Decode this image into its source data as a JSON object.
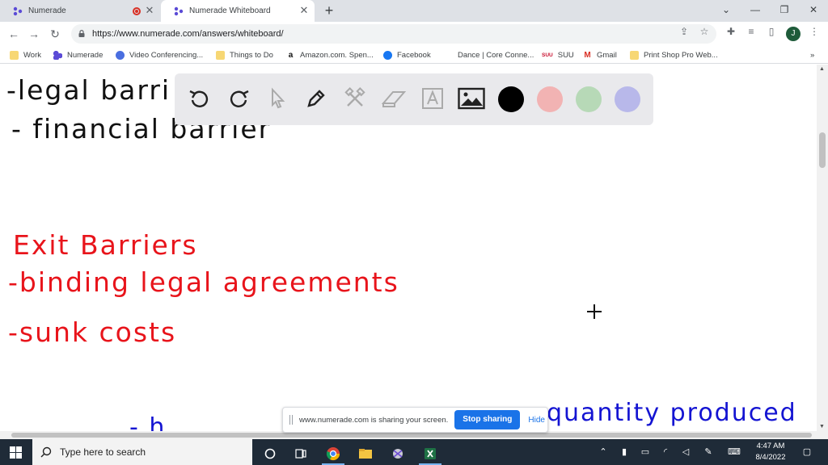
{
  "browser": {
    "tabs": [
      {
        "label": "Numerade",
        "recording": true
      },
      {
        "label": "Numerade Whiteboard",
        "active": true
      }
    ],
    "new_tab_symbol": "+",
    "window_controls": [
      "chevron-down",
      "minimize",
      "restore",
      "close"
    ],
    "url": "https://www.numerade.com/answers/whiteboard/",
    "profile_initial": "J",
    "bookmarks": [
      {
        "label": "Work",
        "icon": "folder-icon"
      },
      {
        "label": "Numerade",
        "icon": "numerade-icon"
      },
      {
        "label": "Video Conferencing...",
        "icon": "video-icon"
      },
      {
        "label": "Things to Do",
        "icon": "folder-icon"
      },
      {
        "label": "Amazon.com. Spen...",
        "icon": "amazon-icon"
      },
      {
        "label": "Facebook",
        "icon": "facebook-icon"
      },
      {
        "label": "Dance | Core Conne...",
        "icon": "page-icon"
      },
      {
        "label": "SUU",
        "icon": "suu-icon",
        "badge": "SUU"
      },
      {
        "label": "Gmail",
        "icon": "gmail-icon"
      },
      {
        "label": "Print Shop Pro Web...",
        "icon": "folder-icon"
      }
    ],
    "more_bookmarks": "»"
  },
  "whiteboard": {
    "handwriting": {
      "line1": "-legal barri",
      "line2": "- financial barrier",
      "exit_title": "Exit Barriers",
      "exit_item1": "-binding legal agreements",
      "exit_item2": "-sunk costs",
      "bottom_left_fragment": "- h",
      "bottom_right": "quantity produced"
    },
    "ink_colors": {
      "black": "#111111",
      "red": "#e8141b",
      "blue": "#1414d2"
    },
    "toolbar": {
      "tools": [
        "undo-icon",
        "redo-icon",
        "pointer-icon",
        "pen-icon",
        "tools-icon",
        "eraser-icon",
        "text-icon",
        "image-icon"
      ],
      "colors": [
        "#000000",
        "#f2b3b3",
        "#b7d9b7",
        "#b8b8ea"
      ]
    }
  },
  "share_bar": {
    "message": "www.numerade.com is sharing your screen.",
    "stop_label": "Stop sharing",
    "hide_label": "Hide"
  },
  "taskbar": {
    "search_placeholder": "Type here to search",
    "time": "4:47 AM",
    "date": "8/4/2022"
  }
}
